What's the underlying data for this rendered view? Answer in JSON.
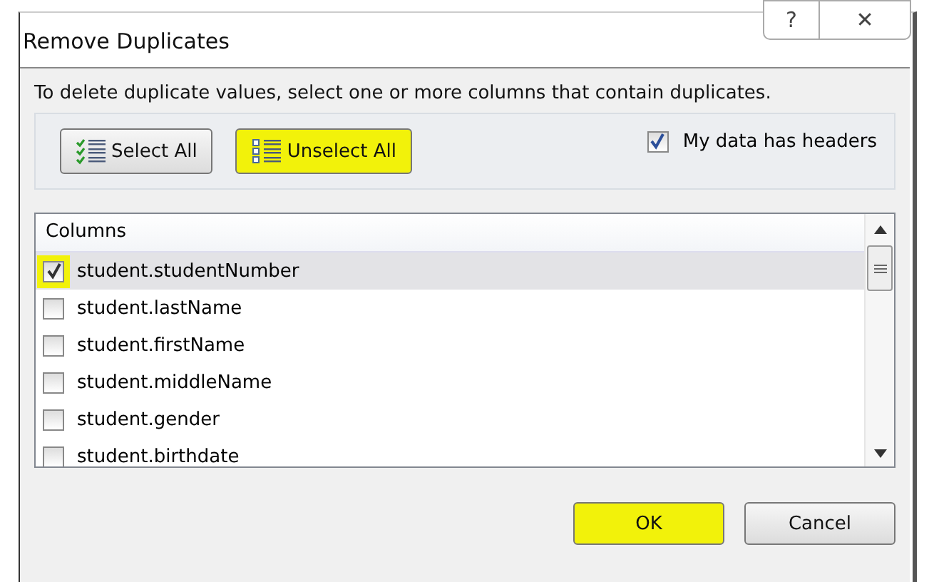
{
  "window": {
    "title": "Remove Duplicates",
    "title_buttons": [
      {
        "kind": "help",
        "label": "?"
      },
      {
        "kind": "close",
        "label": "✕"
      }
    ]
  },
  "instruction": "To delete duplicate values, select one or more columns that contain duplicates.",
  "toolbar": [
    {
      "kind": "select_all",
      "label": "Select All",
      "highlighted": false
    },
    {
      "kind": "unselect_all",
      "label": "Unselect All",
      "highlighted": true
    }
  ],
  "headers_option": {
    "label": "My data has headers",
    "checked": true
  },
  "columns": {
    "header": "Columns",
    "rows": [
      {
        "label": "student.studentNumber",
        "checked": true,
        "selected": true,
        "highlighted": true
      },
      {
        "label": "student.lastName",
        "checked": false,
        "selected": false,
        "highlighted": false
      },
      {
        "label": "student.firstName",
        "checked": false,
        "selected": false,
        "highlighted": false
      },
      {
        "label": "student.middleName",
        "checked": false,
        "selected": false,
        "highlighted": false
      },
      {
        "label": "student.gender",
        "checked": false,
        "selected": false,
        "highlighted": false
      },
      {
        "label": "student.birthdate",
        "checked": false,
        "selected": false,
        "highlighted": false
      }
    ]
  },
  "buttons": [
    {
      "label": "OK",
      "highlighted": true
    },
    {
      "label": "Cancel",
      "highlighted": false
    }
  ]
}
